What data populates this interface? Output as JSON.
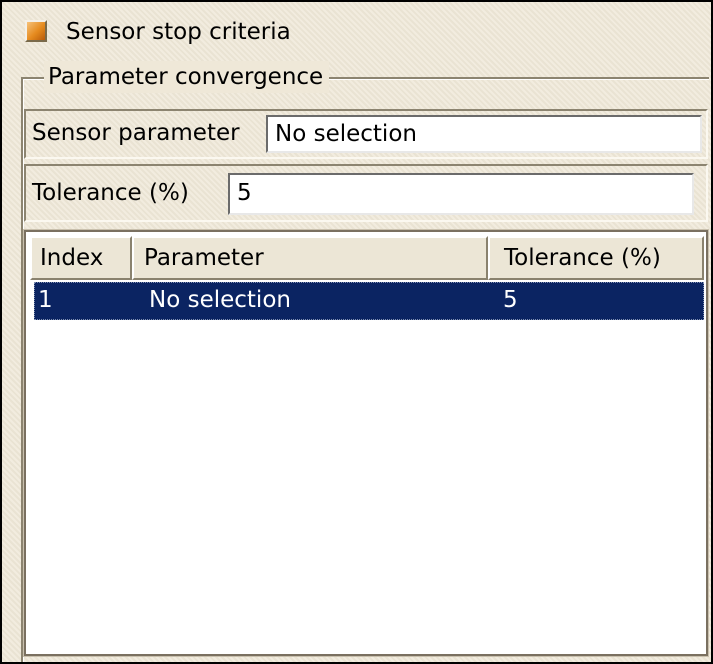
{
  "header": {
    "checkbox_checked": true,
    "checkbox_color": "#e58a1e",
    "title": "Sensor stop criteria"
  },
  "group": {
    "legend": "Parameter convergence"
  },
  "sensor_parameter": {
    "label": "Sensor parameter",
    "value": "No selection"
  },
  "tolerance": {
    "label": "Tolerance (%)",
    "value": "5"
  },
  "table": {
    "columns": [
      "Index",
      "Parameter",
      "Tolerance (%)"
    ],
    "rows": [
      {
        "index": "1",
        "parameter": "No selection",
        "tolerance": "5",
        "selected": true
      }
    ],
    "selection_color": "#0b2462"
  }
}
